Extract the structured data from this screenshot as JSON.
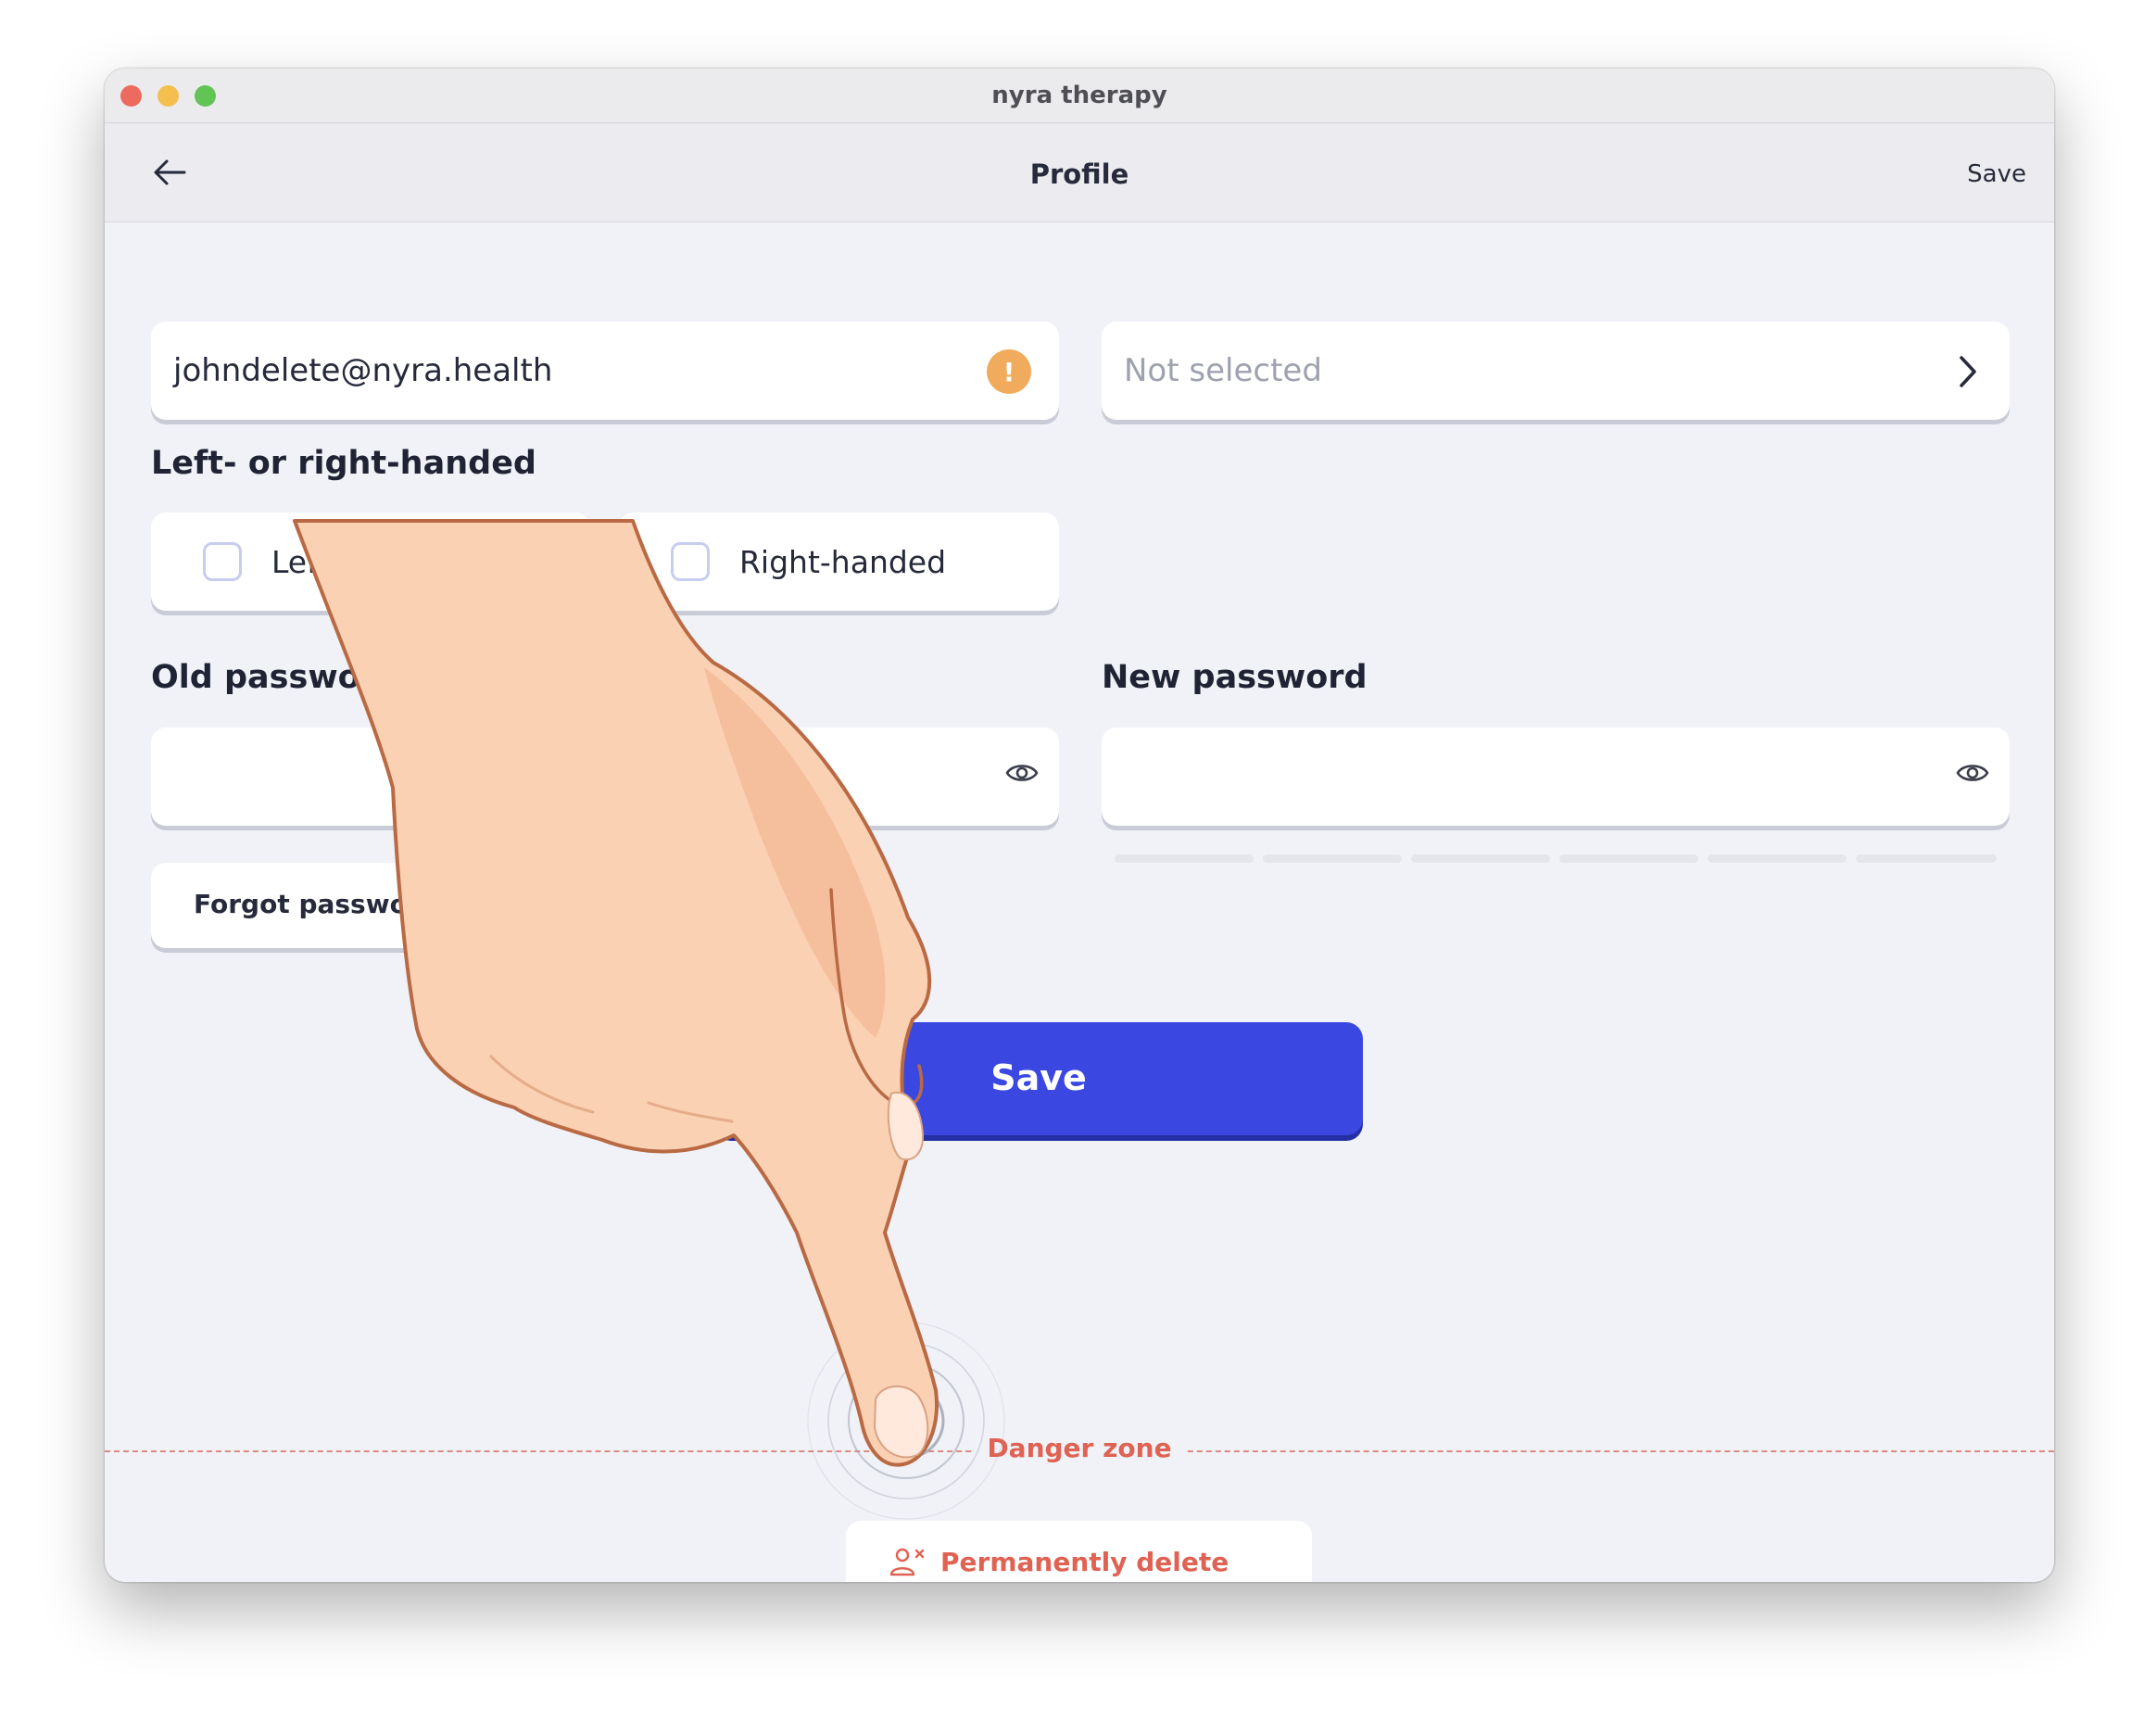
{
  "window": {
    "title": "nyra therapy"
  },
  "navbar": {
    "title": "Profile",
    "save_label": "Save",
    "back_icon": "arrow-left-icon"
  },
  "email": {
    "value": "johndelete@nyra.health",
    "warning_icon": "exclamation-icon",
    "warning_symbol": "!"
  },
  "select": {
    "value": "Not selected",
    "icon": "chevron-right-icon"
  },
  "handedness": {
    "heading": "Left- or right-handed",
    "options": [
      {
        "label": "Left-handed",
        "checked": false
      },
      {
        "label": "Right-handed",
        "checked": false
      }
    ]
  },
  "old_password": {
    "label": "Old passwo",
    "value": "",
    "icon": "eye-icon"
  },
  "new_password": {
    "label": "New password",
    "value": "",
    "icon": "eye-icon"
  },
  "forgot_password": {
    "label": "Forgot passwor"
  },
  "save_button": {
    "label": "Save"
  },
  "danger_zone": {
    "label": "Danger zone",
    "delete_label": "Permanently delete profile",
    "delete_icon": "delete-user-icon"
  },
  "colors": {
    "primary": "#3a47e0",
    "danger": "#e06252",
    "warning": "#f0ac5c",
    "background": "#f0f2f7"
  }
}
